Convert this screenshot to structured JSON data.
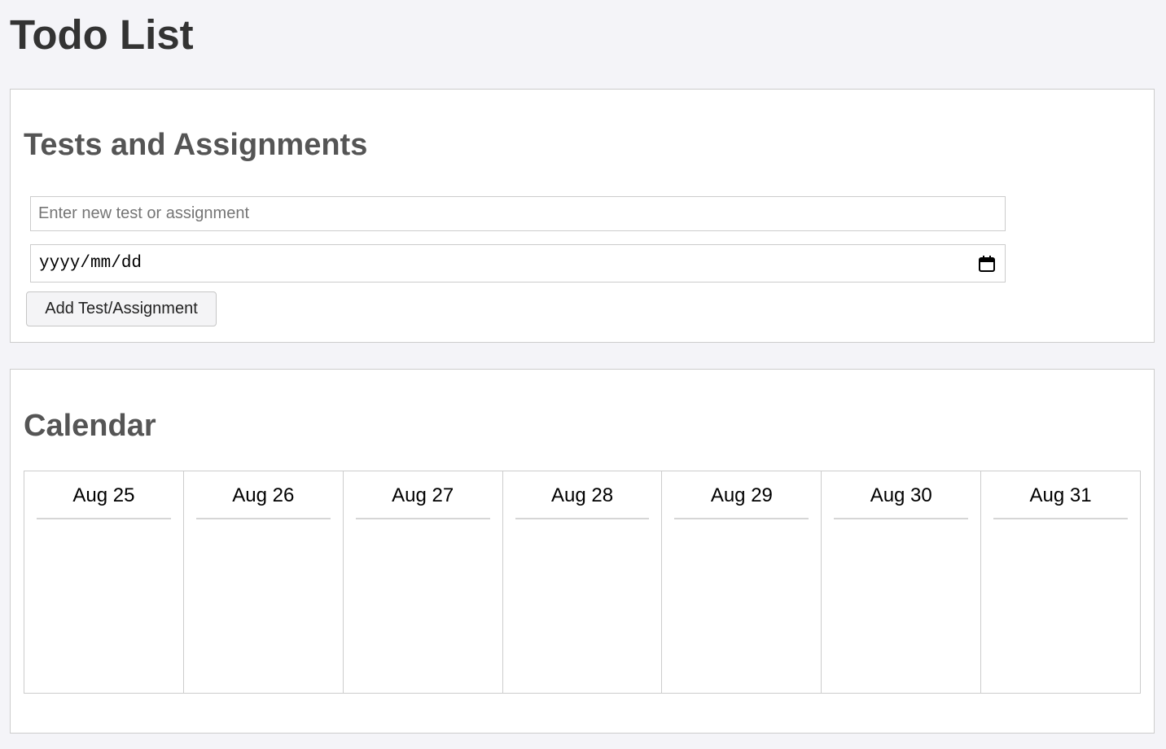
{
  "page": {
    "title": "Todo List"
  },
  "tests_section": {
    "title": "Tests and Assignments",
    "text_input": {
      "value": "",
      "placeholder": "Enter new test or assignment"
    },
    "date_input": {
      "display": "yyyy/mm/dd",
      "icon": "calendar-icon"
    },
    "add_button_label": "Add Test/Assignment"
  },
  "calendar_section": {
    "title": "Calendar",
    "days": [
      {
        "label": "Aug 25"
      },
      {
        "label": "Aug 26"
      },
      {
        "label": "Aug 27"
      },
      {
        "label": "Aug 28"
      },
      {
        "label": "Aug 29"
      },
      {
        "label": "Aug 30"
      },
      {
        "label": "Aug 31"
      }
    ]
  },
  "colors": {
    "page_background": "#f4f4f8",
    "panel_background": "#ffffff",
    "border": "#cccccc",
    "title_text": "#333333",
    "section_title_text": "#555555"
  }
}
